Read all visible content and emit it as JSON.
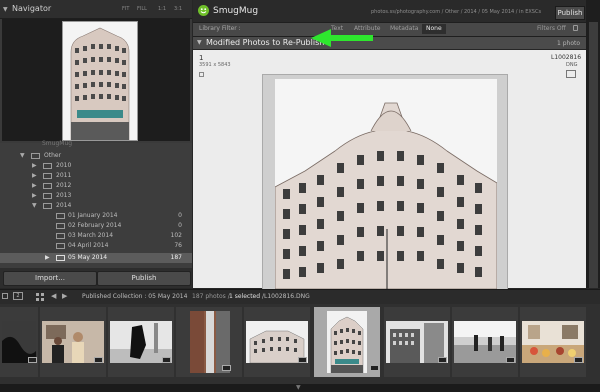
{
  "navigator": {
    "title": "Navigator",
    "zoom": [
      "FIT",
      "FILL",
      "1:1",
      "3:1"
    ]
  },
  "folders": {
    "partial_row": "SmugMug",
    "items": [
      {
        "label": "Other",
        "count": ""
      },
      {
        "label": "2010",
        "count": ""
      },
      {
        "label": "2011",
        "count": ""
      },
      {
        "label": "2012",
        "count": ""
      },
      {
        "label": "2013",
        "count": ""
      },
      {
        "label": "2014",
        "count": ""
      },
      {
        "label": "01 January 2014",
        "count": "0"
      },
      {
        "label": "02 February 2014",
        "count": "0"
      },
      {
        "label": "03 March 2014",
        "count": "102"
      },
      {
        "label": "04 April 2014",
        "count": "76"
      },
      {
        "label": "05 May 2014",
        "count": "187"
      }
    ]
  },
  "left_buttons": {
    "import": "Import...",
    "publish": "Publish"
  },
  "header": {
    "service": "SmugMug",
    "path": "photos.ss/photography.com / Other / 2014 / 05 May 2014 / in EXSCs",
    "publish_button": "Publish"
  },
  "filter": {
    "label": "Library Filter :",
    "options": [
      "Text",
      "Attribute",
      "Metadata",
      "None"
    ],
    "selected": "None",
    "status": "Filters Off"
  },
  "collection": {
    "title": "Modified Photos to Re-Publish",
    "count": "1 photo"
  },
  "photo": {
    "index": "1",
    "dimensions": "3591 x 5843",
    "filename": "L1002816",
    "format": "DNG"
  },
  "filmbar": {
    "page_buttons": [
      "1",
      "2"
    ],
    "source": "Published Collection : 05 May 2014",
    "count": "187 photos /",
    "selected": "1 selected",
    "file": "/L1002816.DNG"
  },
  "colors": {
    "accent_arrow": "#2ee62e",
    "panel": "#3a3a3a",
    "grid": "#ececec"
  }
}
